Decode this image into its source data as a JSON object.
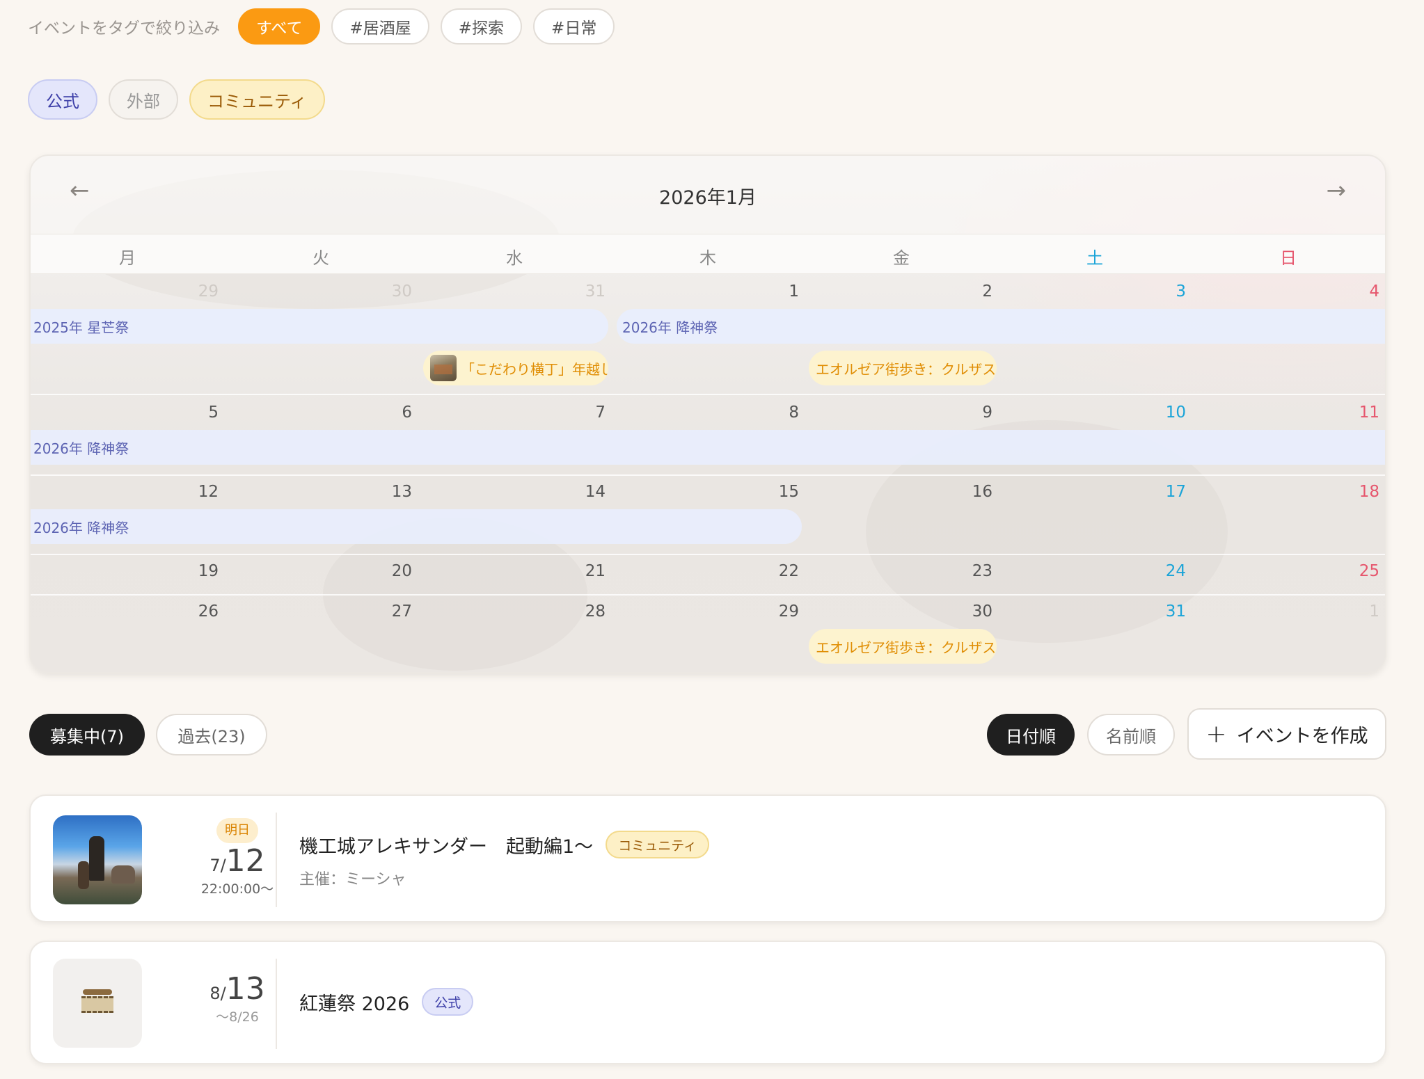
{
  "tag_filter": {
    "label": "イベントをタグで絞り込み",
    "tags": [
      "すべて",
      "#居酒屋",
      "#探索",
      "#日常"
    ],
    "active": "すべて"
  },
  "source_filter": {
    "official": "公式",
    "external": "外部",
    "community": "コミュニティ"
  },
  "calendar": {
    "title": "2026年1月",
    "prev": "←",
    "next": "→",
    "weekdays": [
      "月",
      "火",
      "水",
      "木",
      "金",
      "土",
      "日"
    ],
    "weeks": [
      [
        "29",
        "30",
        "31",
        "1",
        "2",
        "3",
        "4"
      ],
      [
        "5",
        "6",
        "7",
        "8",
        "9",
        "10",
        "11"
      ],
      [
        "12",
        "13",
        "14",
        "15",
        "16",
        "17",
        "18"
      ],
      [
        "19",
        "20",
        "21",
        "22",
        "23",
        "24",
        "25"
      ],
      [
        "26",
        "27",
        "28",
        "29",
        "30",
        "31",
        "1"
      ]
    ],
    "events": {
      "seiga": "2025年 星芒祭",
      "kojin_w1": "2026年 降神祭",
      "kojin_w2": "2026年 降神祭",
      "kojin_w3": "2026年 降神祭",
      "kodawari": "「こだわり横丁」年越し…",
      "eorzea1": "エオルゼア街歩き：クルザス編",
      "eorzea2": "エオルゼア街歩き：クルザス…"
    }
  },
  "list_controls": {
    "recruiting": "募集中(7)",
    "past": "過去(23)",
    "sort_date": "日付順",
    "sort_name": "名前順",
    "create_plus": "+",
    "create": "イベントを作成"
  },
  "events": [
    {
      "badge": "明日",
      "month": "7/",
      "day": "12",
      "time": "22:00:00〜",
      "title": "機工城アレキサンダー　起動編1〜",
      "category": "コミュニティ",
      "host": "主催：ミーシャ"
    },
    {
      "month": "8/",
      "day": "13",
      "until": "〜8/26",
      "title": "紅蓮祭 2026",
      "category": "公式"
    }
  ],
  "colors": {
    "accent_orange": "#fb9a12",
    "official_purple": "#3d3fa8",
    "community_amber": "#9a5a06",
    "saturday": "#1ba4d8",
    "sunday": "#e6566d",
    "event_bar": "#e8eefd",
    "event_chip": "#fdf3cf"
  }
}
